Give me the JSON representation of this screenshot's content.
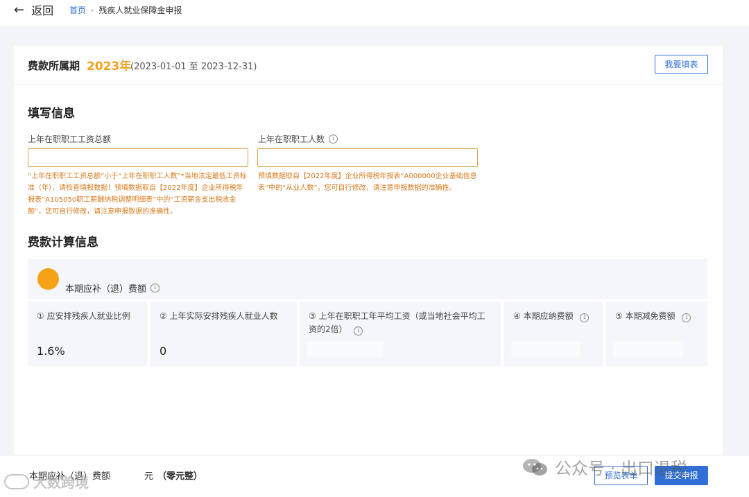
{
  "nav": {
    "back_label": "返回",
    "breadcrumb": {
      "home": "首页",
      "current": "残疾人就业保障金申报"
    }
  },
  "period": {
    "label": "费款所属期",
    "year": "2023年",
    "range": "(2023-01-01 至 2023-12-31)",
    "fill_button": "我要填表"
  },
  "fill_info": {
    "title": "填写信息",
    "total_wage": {
      "label": "上年在职职工工资总额",
      "value": "",
      "hint": "“上年在职职工工资总额”小于“上年在职职工人数”*当地法定最低工资标准（年），请检查填报数据！预填数据取自【2022年度】企业所得税年报表“A105050职工薪酬纳税调整明细表”中的“工资薪金支出税收金额”，您可自行修改，请注意申报数据的准确性。"
    },
    "employee_count": {
      "label": "上年在职职工人数",
      "value": "",
      "hint": "预填数据取自【2022年度】企业所得税年报表“A000000企业基础信息表”中的“从业人数”，您可自行修改，请注意申报数据的准确性。"
    }
  },
  "calc": {
    "title": "费款计算信息",
    "header_label": "本期应补（退）费额",
    "cells": [
      {
        "label": "① 应安排残疾人就业比例",
        "value": "1.6%"
      },
      {
        "label": "② 上年实际安排残疾人就业人数",
        "value": "0"
      },
      {
        "label": "③ 上年在职职工年平均工资（或当地社会平均工资的2倍）",
        "value": ""
      },
      {
        "label": "④ 本期应纳费额",
        "value": ""
      },
      {
        "label": "⑤ 本期减免费额",
        "value": ""
      }
    ]
  },
  "footer": {
    "label": "本期应补（退）费额",
    "unit": "元",
    "amount_text": "（零元整）",
    "preview_button": "预览表单",
    "submit_button": "提交申报"
  },
  "watermarks": {
    "right": "公众号 · 出口退税",
    "left": "大数跨境"
  },
  "colors": {
    "accent_blue": "#2f6fd6",
    "year_orange": "#f2a21c",
    "hint_orange": "#d97a1c",
    "dot_orange": "#f7a117"
  }
}
